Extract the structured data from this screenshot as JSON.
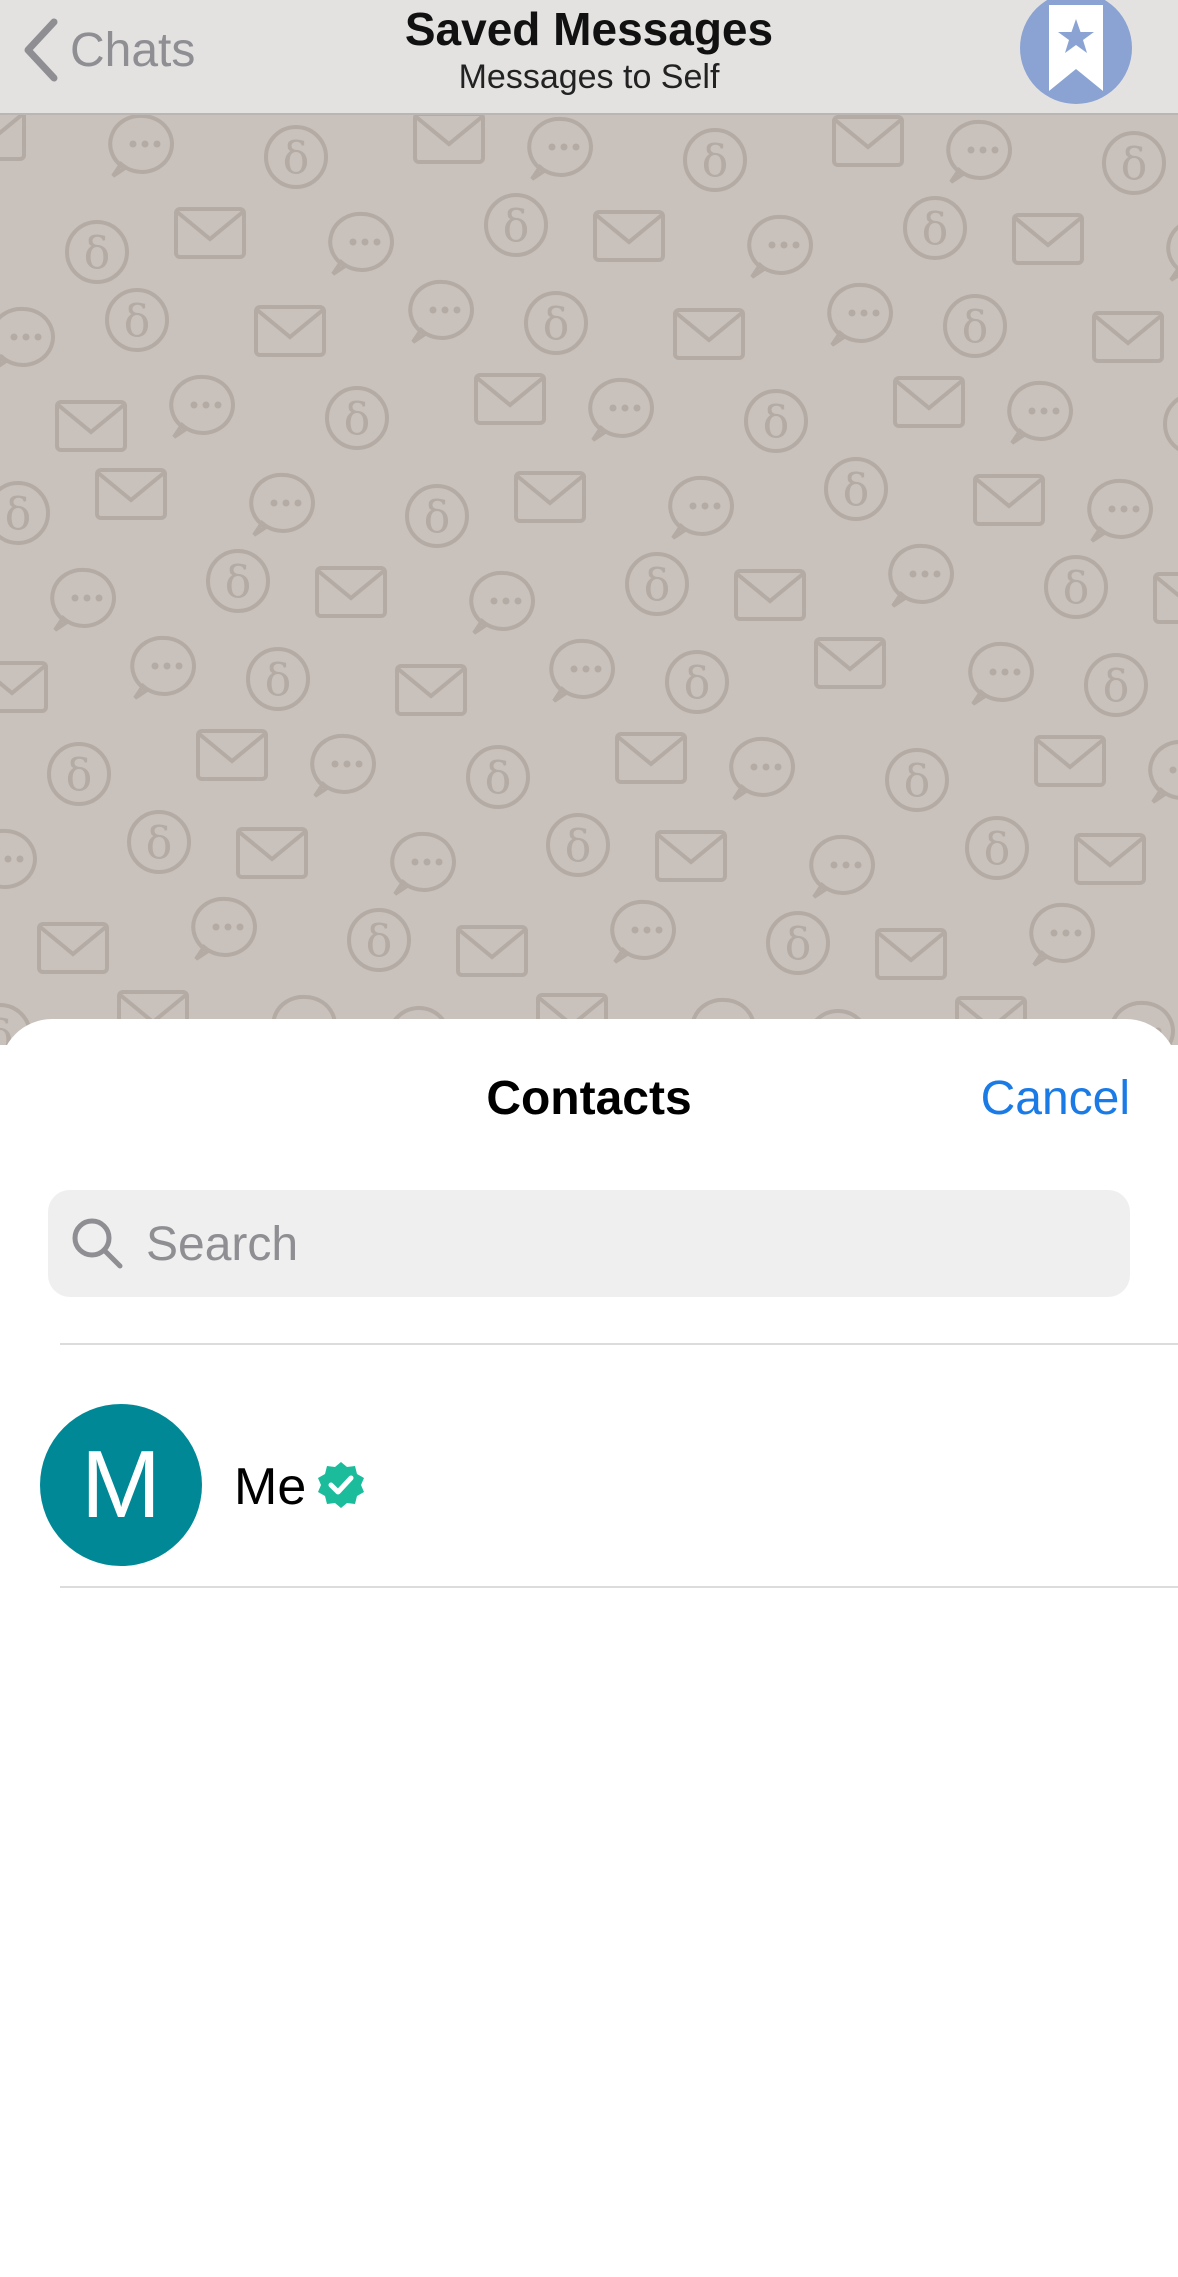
{
  "navbar": {
    "back_label": "Chats",
    "title": "Saved Messages",
    "subtitle": "Messages to Self",
    "avatar_icon": "bookmark-star-icon"
  },
  "sheet": {
    "title": "Contacts",
    "cancel_label": "Cancel",
    "search": {
      "placeholder": "Search",
      "value": ""
    },
    "contacts": [
      {
        "name": "Me",
        "initial": "M",
        "verified": true,
        "avatar_color": "#008897"
      }
    ]
  },
  "colors": {
    "accent": "#1a7be7",
    "chat_background": "#c9c1bb",
    "verified_badge": "#1abc9c"
  }
}
